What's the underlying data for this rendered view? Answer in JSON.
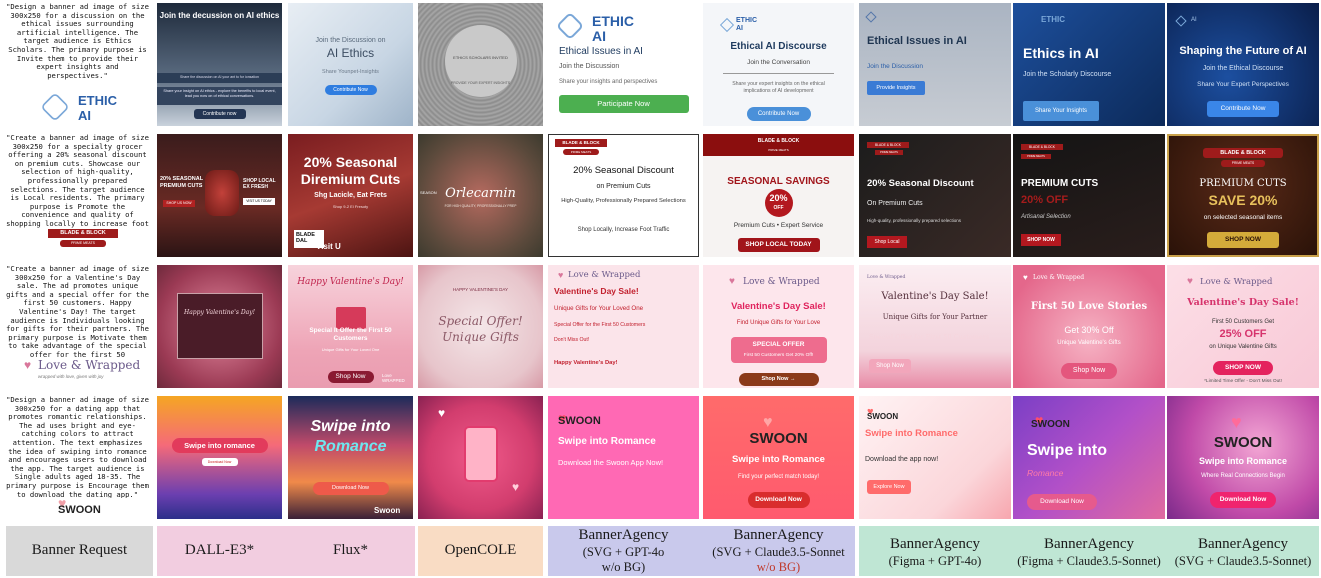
{
  "prompts": {
    "ethic": "\"Design a banner ad image of size 300x250 for a discussion on the ethical issues surrounding artificial intelligence. The target audience is Ethics Scholars. The primary purpose is Invite them to provide their expert insights and perspectives.\"",
    "blade": "\"Create a banner ad image of size 300x250 for a specialty grocer offering a 20% seasonal discount on premium cuts. Showcase our selection of high-quality, professionally prepared selections. The target audience is Local residents. The primary purpose is Promote the convenience and quality of shopping locally to increase foot traffic.\"",
    "love": "\"Create a banner ad image of size 300x250 for a Valentine's Day sale. The ad promotes unique gifts and a special offer for the first 50 customers. Happy Valentine's Day! The target audience is Individuals looking for gifts for their partners. The primary purpose is Motivate them to take advantage of the special offer for the first 50 customers.\"",
    "swoon": "\"Design a banner ad image of size 300x250 for a dating app that promotes romantic relationships. The ad uses bright and eye-catching colors to attract attention. The text emphasizes the idea of swiping into romance and encourages users to download the app. The target audience is Single adults aged 18-35. The primary purpose is Encourage them to download the dating app.\""
  },
  "logos": {
    "ethic_line1": "ETHIC",
    "ethic_line2": "AI",
    "blade": "BLADE & BLOCK",
    "blade_sub": "PRIME MEATS",
    "love": "Love & Wrapped",
    "love_sub": "wrapped with love, given with joy",
    "swoon": "SWOON"
  },
  "row1": {
    "t1_title": "Join the decussion on AI ethics",
    "t1_line": "Share the discussion on AI your ant to for ionsation",
    "t1_body": "Share your insight on AI ethics - explore the benefits to local event, lead you now on of ethical conversations.",
    "t1_btn": "Contribute now",
    "t2_small": "Join the Discussion on",
    "t2_title": "AI Ethics",
    "t2_sub": "Share Younpet-Insights",
    "t2_btn": "Contribute Now",
    "t3_title": "ETHICS SCHOLARS INVITED",
    "t3_sub": "PROVIDE YOUR EXPERT INSIGHTS",
    "t4_title": "Ethical Issues in AI",
    "t4_l1": "Join the Discussion",
    "t4_l2": "Share your insights and perspectives",
    "t4_btn": "Participate Now",
    "t5_title": "Ethical AI Discourse",
    "t5_l1": "Join the Conversation",
    "t5_l2": "Share your expert insights on the ethical implications of AI development",
    "t5_btn": "Contribute Now",
    "t6_title": "Ethical Issues in AI",
    "t6_l1": "Join the Discussion",
    "t6_btn": "Provide Insights",
    "t7_title": "Ethics in AI",
    "t7_l1": "Join the Scholarly Discourse",
    "t7_btn": "Share Your Insights",
    "t8_title": "Shaping the Future of AI",
    "t8_l1": "Join the Ethical Discourse",
    "t8_l2": "Share Your Expert Perspectives",
    "t8_btn": "Contribute Now"
  },
  "row2": {
    "t1_title": "20% SEASONAL PREMIUM CUTS",
    "t1_left_btn": "SHOP US NOW",
    "t1_right": "SHOP LOCAL EX FRESH",
    "t1_right_btn": "VISIT US TODAY",
    "t2_title": "20% Seasonal Diremium Cuts",
    "t2_sub": "Shg Lacicle, Eat Frets",
    "t2_small": "Shop 9-2 El Fresoty",
    "t2_logo": "BLADE DAL",
    "t2_btn": "Visit U",
    "t3_title": "Orlecarnin",
    "t3_left": "SEASON",
    "t3_sub": "FOR HIGH QUALITY, PROFESSIONALLY PREP",
    "t4_title": "20% Seasonal Discount",
    "t4_l1": "on Premium Cuts",
    "t4_l2": "High-Quality, Professionally Prepared Selections",
    "t4_l3": "Shop Locally, Increase Foot Traffic",
    "t5_title": "SEASONAL SAVINGS",
    "t5_badge1": "20%",
    "t5_badge2": "OFF",
    "t5_l1": "Premium Cuts • Expert Service",
    "t5_btn": "SHOP LOCAL TODAY",
    "t6_title": "20% Seasonal Discount",
    "t6_l1": "On Premium Cuts",
    "t6_l2": "High-quality, professionally prepared selections",
    "t6_btn": "Shop Local",
    "t7_title": "PREMIUM CUTS",
    "t7_off": "20% OFF",
    "t7_l1": "Artisanal Selection",
    "t7_btn": "SHOP NOW",
    "t8_l1": "PREMIUM CUTS",
    "t8_title": "SAVE 20%",
    "t8_l2": "on selected seasonal items",
    "t8_btn": "SHOP NOW"
  },
  "row3": {
    "t1_title": "Happy Valentine's Day!",
    "t2_title": "Happy Valentine's Day!",
    "t2_l1": "Special It Offer the First 50 Customers",
    "t2_l2": "Unique Gifts for Your Loved One",
    "t2_btn": "Shop Now",
    "t2_logo": "Love WRAPPED",
    "t3_top": "HAPPY VALENTINE'S DAY",
    "t3_title": "Special Offer! Unique Gifts",
    "t4_title": "Valentine's Day Sale!",
    "t4_l1": "Unique Gifts for Your Loved One",
    "t4_l2": "Special Offer for the First 50 Customers",
    "t4_l3": "Don't Miss Out!",
    "t4_l4": "Happy Valentine's Day!",
    "t5_title": "Valentine's Day Sale!",
    "t5_l1": "Find Unique Gifts for Your Love",
    "t5_box1": "SPECIAL OFFER",
    "t5_box2": "First 50 Customers Get 20% Off!",
    "t5_btn": "Shop Now →",
    "t6_title": "Valentine's Day Sale!",
    "t6_l1": "Unique Gifts for Your Partner",
    "t6_l2": "Special Offer for First 50 Customers",
    "t6_btn": "Shop Now",
    "t7_title": "First 50 Love Stories",
    "t7_l1": "Get 30% Off",
    "t7_l2": "Unique Valentine's Gifts",
    "t7_btn": "Shop Now",
    "t8_title": "Valentine's Day Sale!",
    "t8_l1": "First 50 Customers Get",
    "t8_l2": "25% OFF",
    "t8_l3": "on Unique Valentine Gifts",
    "t8_btn": "SHOP NOW",
    "t8_l4": "*Limited Time Offer - Don't Miss Out!"
  },
  "row4": {
    "t1_title": "Swipe into romance",
    "t1_btn": "Download Now",
    "t2_title1": "Swipe into",
    "t2_title2": "Romance",
    "t2_btn": "Download Now",
    "t2_logo": "Swoon",
    "t4_title": "Swipe into Romance",
    "t4_l1": "Download the Swoon App Now!",
    "t5_title": "Swipe into Romance",
    "t5_l1": "Find your perfect match today!",
    "t5_btn": "Download Now",
    "t6_title": "Swipe into Romance",
    "t6_l1": "Download the app now!",
    "t6_btn": "Explore Now",
    "t7_title1": "Swipe into",
    "t7_title2": "Romance",
    "t7_btn": "Download Now",
    "t8_title": "Swipe into Romance",
    "t8_l1": "Where Real Connections Begin",
    "t8_btn": "Download Now"
  },
  "footer": {
    "request": "Banner Request",
    "dalle": "DALL-E3*",
    "flux": "Flux*",
    "opencole": "OpenCOLE",
    "ba1_l1": "BannerAgency",
    "ba1_l2": "(SVG + GPT-4o",
    "ba1_l3": "w/o BG)",
    "ba2_l1": "BannerAgency",
    "ba2_l2": "(SVG + Claude3.5-Sonnet",
    "ba2_l3": "w/o BG)",
    "ba3_l1": "BannerAgency",
    "ba3_l2": "(Figma + GPT-4o)",
    "ba4_l1": "BannerAgency",
    "ba4_l2": "(Figma + Claude3.5-Sonnet)",
    "ba5_l1": "BannerAgency",
    "ba5_l2": "(SVG + Claude3.5-Sonnet)"
  },
  "colors": {
    "footer_grey": "#d9d9d9",
    "footer_pink": "#f2cde0",
    "footer_peach": "#f9dcc4",
    "footer_lavender": "#c9c9ec",
    "footer_mint": "#bfe6d4",
    "wo_bg_red": "#c0392b"
  }
}
